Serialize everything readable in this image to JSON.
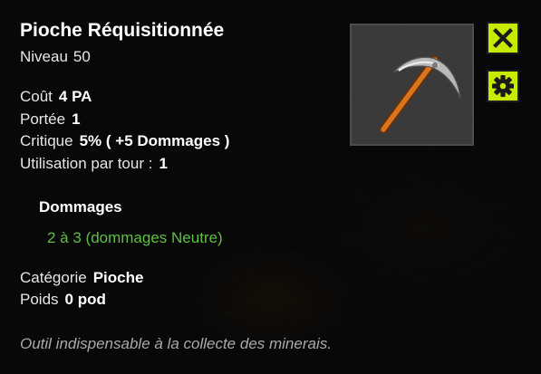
{
  "item": {
    "name": "Pioche Réquisitionnée",
    "level_label": "Niveau",
    "level_value": "50"
  },
  "stats": {
    "cost_label": "Coût",
    "cost_value": "4 PA",
    "range_label": "Portée",
    "range_value": "1",
    "critical_label": "Critique",
    "critical_value": "5% ( +5 Dommages )",
    "uses_label": "Utilisation par tour :",
    "uses_value": "1"
  },
  "damage": {
    "title": "Dommages",
    "line": "2 à 3 (dommages Neutre)"
  },
  "meta": {
    "category_label": "Catégorie",
    "category_value": "Pioche",
    "weight_label": "Poids",
    "weight_value": "0 pod"
  },
  "description": "Outil indispensable à la collecte des minerais.",
  "icons": {
    "item": "pickaxe-icon",
    "close": "close-icon",
    "settings": "gear-icon"
  },
  "colors": {
    "accent": "#c8ea00",
    "damage_text": "#5fbf43",
    "description_text": "#a9a9a9"
  }
}
